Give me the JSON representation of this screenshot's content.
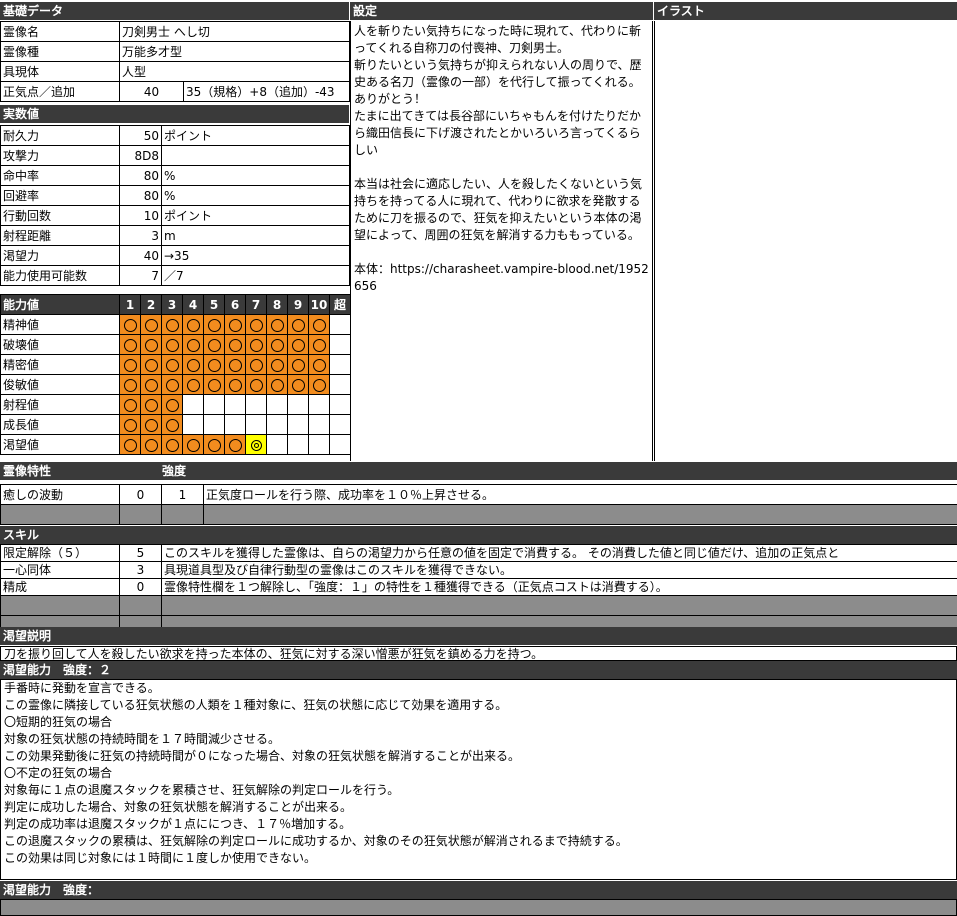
{
  "basic": {
    "header": "基礎データ",
    "rows": [
      {
        "label": "霊像名",
        "value": "刀剣男士 へし切"
      },
      {
        "label": "霊像種",
        "value": "万能多才型"
      },
      {
        "label": "具現体",
        "value": "人型"
      }
    ],
    "sanity": {
      "label": "正気点／追加",
      "value": "40",
      "detail": "35（規格）+8（追加）-43"
    }
  },
  "stats": {
    "header": "実数値",
    "rows": [
      {
        "label": "耐久力",
        "value": "50",
        "unit": "ポイント"
      },
      {
        "label": "攻撃力",
        "value": "8D8",
        "unit": ""
      },
      {
        "label": "命中率",
        "value": "80",
        "unit": "%"
      },
      {
        "label": "回避率",
        "value": "80",
        "unit": "%"
      },
      {
        "label": "行動回数",
        "value": "10",
        "unit": "ポイント"
      },
      {
        "label": "射程距離",
        "value": "3",
        "unit": "m"
      },
      {
        "label": "渇望力",
        "value": "40",
        "unit": "→35"
      },
      {
        "label": "能力使用可能数",
        "value": "7",
        "unit": "／7"
      }
    ]
  },
  "abilities": {
    "header": "能力値",
    "columns": [
      "1",
      "2",
      "3",
      "4",
      "5",
      "6",
      "7",
      "8",
      "9",
      "10",
      "超"
    ],
    "rows": [
      {
        "label": "精神値",
        "level": 10,
        "double_at": 0
      },
      {
        "label": "破壊値",
        "level": 10,
        "double_at": 0
      },
      {
        "label": "精密値",
        "level": 10,
        "double_at": 0
      },
      {
        "label": "俊敏値",
        "level": 10,
        "double_at": 0
      },
      {
        "label": "射程値",
        "level": 3,
        "double_at": 0
      },
      {
        "label": "成長値",
        "level": 3,
        "double_at": 0
      },
      {
        "label": "渇望値",
        "level": 6,
        "double_at": 7
      }
    ]
  },
  "settings": {
    "header": "設定",
    "text": "人を斬りたい気持ちになった時に現れて、代わりに斬ってくれる自称刀の付喪神、刀剣男士。\n斬りたいという気持ちが抑えられない人の周りで、歴史ある名刀（霊像の一部）を代行して振ってくれる。ありがとう！\nたまに出てきては長谷部にいちゃもんを付けたりだから織田信長に下げ渡されたとかいろいろ言ってくるらしい\n\n本当は社会に適応したい、人を殺したくないという気持ちを持ってる人に現れて、代わりに欲求を発散するために刀を振るので、狂気を抑えたいという本体の渇望によって、周囲の狂気を解消する力ももっている。\n\n本体：https://charasheet.vampire-blood.net/1952656"
  },
  "illust": {
    "header": "イラスト"
  },
  "traits": {
    "header": "霊像特性",
    "strength_header": "強度",
    "rows": [
      {
        "name": "癒しの波動",
        "value": "0",
        "strength": "1",
        "desc": "正気度ロールを行う際、成功率を１０％上昇させる。"
      }
    ]
  },
  "skills": {
    "header": "スキル",
    "rows": [
      {
        "name": "限定解除（５）",
        "value": "5",
        "desc": "このスキルを獲得した霊像は、自らの渇望力から任意の値を固定で消費する。 その消費した値と同じ値だけ、追加の正気点と"
      },
      {
        "name": "一心同体",
        "value": "3",
        "desc": "具現道具型及び自律行動型の霊像はこのスキルを獲得できない。"
      },
      {
        "name": "精成",
        "value": "0",
        "desc": "霊像特性欄を１つ解除し、「強度：１」の特性を１種獲得できる（正気点コストは消費する）。"
      }
    ]
  },
  "craving_desc": {
    "header": "渇望説明",
    "text": "刀を振り回して人を殺したい欲求を持った本体の、狂気に対する深い憎悪が狂気を鎮める力を持つ。"
  },
  "craving_ability1": {
    "header": "渇望能力　強度：２",
    "text": "手番時に発動を宣言できる。\nこの霊像に隣接している狂気状態の人類を１種対象に、狂気の状態に応じて効果を適用する。\n〇短期的狂気の場合\n対象の狂気状態の持続時間を１７時間減少させる。\nこの効果発動後に狂気の持続時間が０になった場合、対象の狂気状態を解消することが出来る。\n〇不定の狂気の場合\n対象毎に１点の退魔スタックを累積させ、狂気解除の判定ロールを行う。\n判定に成功した場合、対象の狂気状態を解消することが出来る。\n判定の成功率は退魔スタックが１点ににつき、１７％増加する。\nこの退魔スタックの累積は、狂気解除の判定ロールに成功するか、対象のその狂気状態が解消されるまで持続する。\nこの効果は同じ対象には１時間に１度しか使用できない。"
  },
  "craving_ability2": {
    "header": "渇望能力　強度："
  }
}
